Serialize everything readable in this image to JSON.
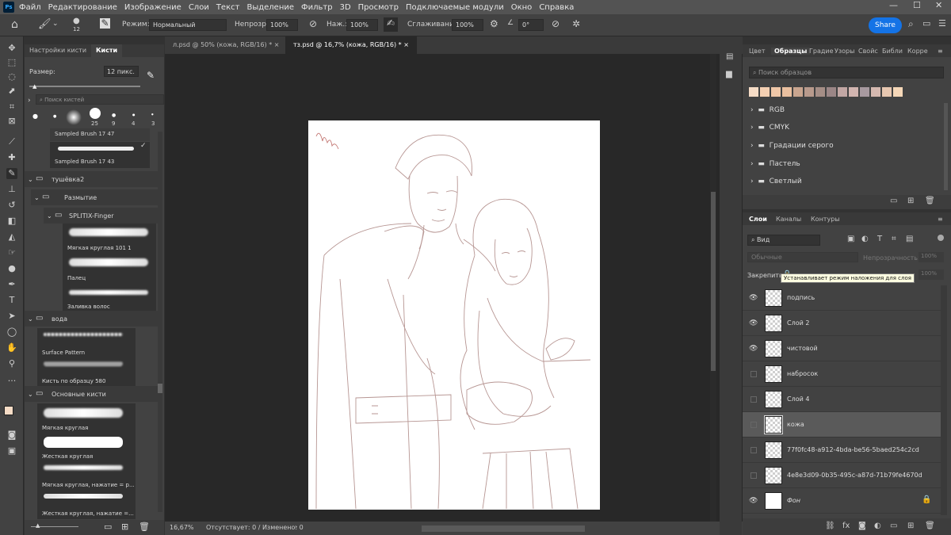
{
  "menubar": {
    "logo": "Ps",
    "items": [
      "Файл",
      "Редактирование",
      "Изображение",
      "Слои",
      "Текст",
      "Выделение",
      "Фильтр",
      "3D",
      "Просмотр",
      "Подключаемые модули",
      "Окно",
      "Справка"
    ]
  },
  "options": {
    "brush_size": "12",
    "mode_label": "Режим:",
    "mode_value": "Нормальный",
    "opacity_label": "Непрозр.:",
    "opacity_value": "100%",
    "pressure_label": "Наж.:",
    "pressure_value": "100%",
    "smoothing_label": "Сглаживание:",
    "smoothing_value": "100%",
    "angle_value": "0°",
    "share_label": "Share"
  },
  "brush_panel": {
    "tabs": [
      "Настройки кисти",
      "Кисти"
    ],
    "size_label": "Размер:",
    "size_value": "12 пикс.",
    "search_placeholder": "Поиск кистей",
    "preset_sizes": [
      "25",
      "9",
      "4",
      "3"
    ],
    "sampled": [
      "Sampled Brush 17 47",
      "Sampled Brush 17 43"
    ],
    "folders": [
      "тушёвка2",
      "Размытие",
      "SPLITIX-Finger",
      "вода",
      "Основные кисти"
    ],
    "brushes": [
      {
        "label": "Мягкая круглая 101 1"
      },
      {
        "label": "Палец"
      },
      {
        "label": "Заливка волос"
      },
      {
        "label": "Surface Pattern"
      },
      {
        "label": "Кисть по образцу 580"
      },
      {
        "label": "Мягкая круглая"
      },
      {
        "label": "Жесткая круглая"
      },
      {
        "label": "Мягкая круглая, нажатие = р..."
      },
      {
        "label": "Жесткая круглая, нажатие =..."
      }
    ]
  },
  "doc": {
    "tabs": [
      "л.psd @ 50% (кожа, RGB/16) *",
      "тз.psd @ 16,7% (кожа, RGB/16) *"
    ],
    "zoom": "16,67%",
    "status": "Отсутствует: 0 / Изменено: 0"
  },
  "swatches": {
    "tabs": [
      "Цвет",
      "Образцы",
      "Градие",
      "Узоры",
      "Свойс",
      "Библи",
      "Корре"
    ],
    "search_placeholder": "Поиск образцов",
    "colors": [
      "#f6dcc6",
      "#f3cfb2",
      "#efc7a8",
      "#e9bf9f",
      "#c9a58f",
      "#b89a8c",
      "#a58e86",
      "#9b8686",
      "#c2a7a4",
      "#d2b5b0",
      "#a89aa0",
      "#d5b9b0",
      "#e7c7b0",
      "#f5d7b8"
    ],
    "groups": [
      "RGB",
      "CMYK",
      "Градации серого",
      "Пастель",
      "Светлый"
    ]
  },
  "layers": {
    "tabs": [
      "Слои",
      "Каналы",
      "Контуры"
    ],
    "filter_label": "Вид",
    "blend_mode": "Обычные",
    "opacity_label": "Непрозрачность:",
    "opacity_value": "100%",
    "lock_label": "Закрепить:",
    "fill_value": "100%",
    "tooltip": "Устанавливает режим наложения для слоя",
    "items": [
      {
        "name": "подпись",
        "visible": true
      },
      {
        "name": "Слой 2",
        "visible": true
      },
      {
        "name": "чистовой",
        "visible": true
      },
      {
        "name": "набросок",
        "visible": false
      },
      {
        "name": "Слой 4",
        "visible": false
      },
      {
        "name": "кожа",
        "visible": false,
        "selected": true
      },
      {
        "name": "77f0fc48-a912-4bda-be56-5baed254c2cd",
        "visible": false
      },
      {
        "name": "4e8e3d09-0b35-495c-a87d-71b79fe4670d",
        "visible": false
      },
      {
        "name": "Фон",
        "visible": true
      }
    ]
  },
  "icons": [
    "home-icon",
    "brush-icon",
    "gear-icon",
    "lock-icon",
    "eye-icon",
    "folder-icon",
    "trash-icon",
    "plus-icon",
    "search-icon"
  ]
}
